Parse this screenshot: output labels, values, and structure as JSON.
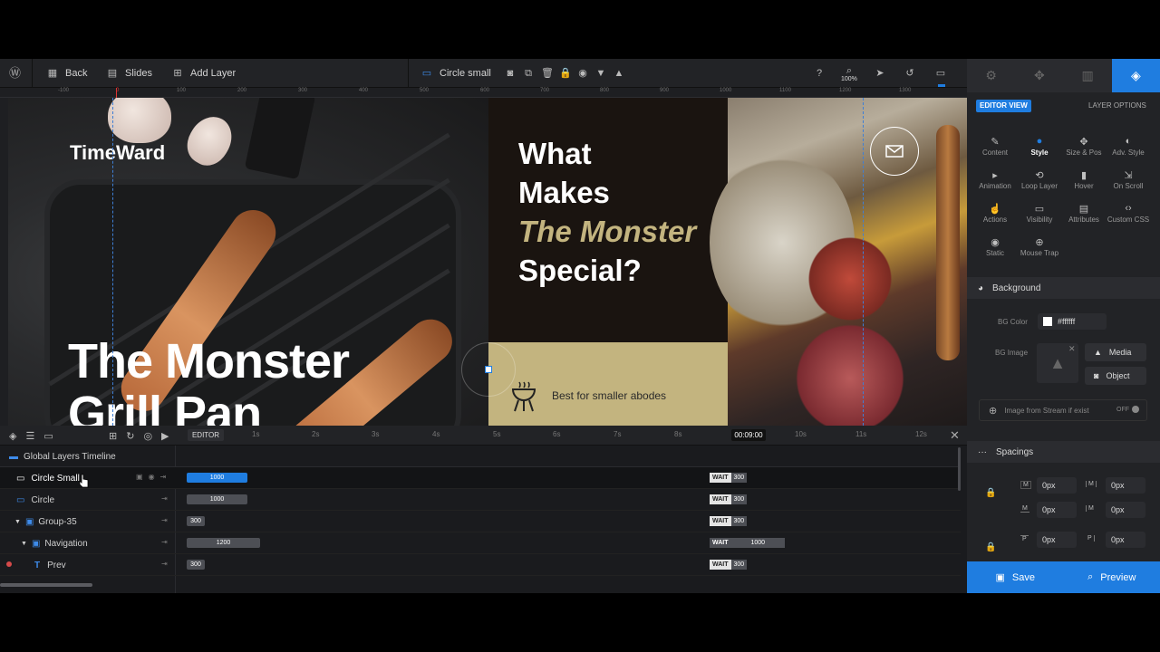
{
  "toolbar": {
    "back": "Back",
    "slides": "Slides",
    "add_layer": "Add Layer",
    "layer_name": "Circle small",
    "zoom": "100%"
  },
  "ruler": [
    "-100",
    "0",
    "100",
    "200",
    "300",
    "400",
    "500",
    "600",
    "700",
    "800",
    "900",
    "1000",
    "1100",
    "1200",
    "1300"
  ],
  "slide": {
    "brand": "TimeWard",
    "hero_line1": "The Monster",
    "hero_line2": "Grill Pan",
    "question_l1": "What",
    "question_l2": "Makes",
    "question_l3": "The Monster",
    "question_l4": "Special?",
    "feature": "Best for smaller abodes"
  },
  "timeline": {
    "editor": "EDITOR",
    "time": "00:09:00",
    "global": "Global Layers Timeline",
    "ticks": [
      "1s",
      "2s",
      "3s",
      "4s",
      "5s",
      "6s",
      "7s",
      "8s",
      "9s",
      "10s",
      "11s",
      "12s"
    ],
    "layers": [
      {
        "name": "Circle Small",
        "bar": "1000",
        "wait": "WAIT",
        "wait_val": "300"
      },
      {
        "name": "Circle",
        "bar": "1000",
        "wait": "WAIT",
        "wait_val": "300"
      },
      {
        "name": "Group-35",
        "bar": "300",
        "wait": "WAIT",
        "wait_val": "300"
      },
      {
        "name": "Navigation",
        "bar": "1200",
        "wait": "WAIT",
        "wait_val": "1000"
      },
      {
        "name": "Prev",
        "bar": "300",
        "wait": "WAIT",
        "wait_val": "300"
      }
    ]
  },
  "panel": {
    "editor_view": "EDITOR VIEW",
    "layer_options": "LAYER OPTIONS",
    "options": [
      "Content",
      "Style",
      "Size & Pos",
      "Adv. Style",
      "Animation",
      "Loop Layer",
      "Hover",
      "On Scroll",
      "Actions",
      "Visibility",
      "Attributes",
      "Custom CSS",
      "Static",
      "Mouse Trap"
    ],
    "background": "Background",
    "bg_color_label": "BG Color",
    "bg_color": "#ffffff",
    "bg_image_label": "BG Image",
    "media": "Media",
    "object": "Object",
    "stream": "Image from Stream if exist",
    "off": "OFF",
    "spacings": "Spacings",
    "m": "M",
    "p": "P",
    "px": "0px",
    "save": "Save",
    "preview": "Preview"
  },
  "colors": {
    "accent": "#1f7de0",
    "gold": "#c3b47f",
    "dark": "#1a1410"
  }
}
